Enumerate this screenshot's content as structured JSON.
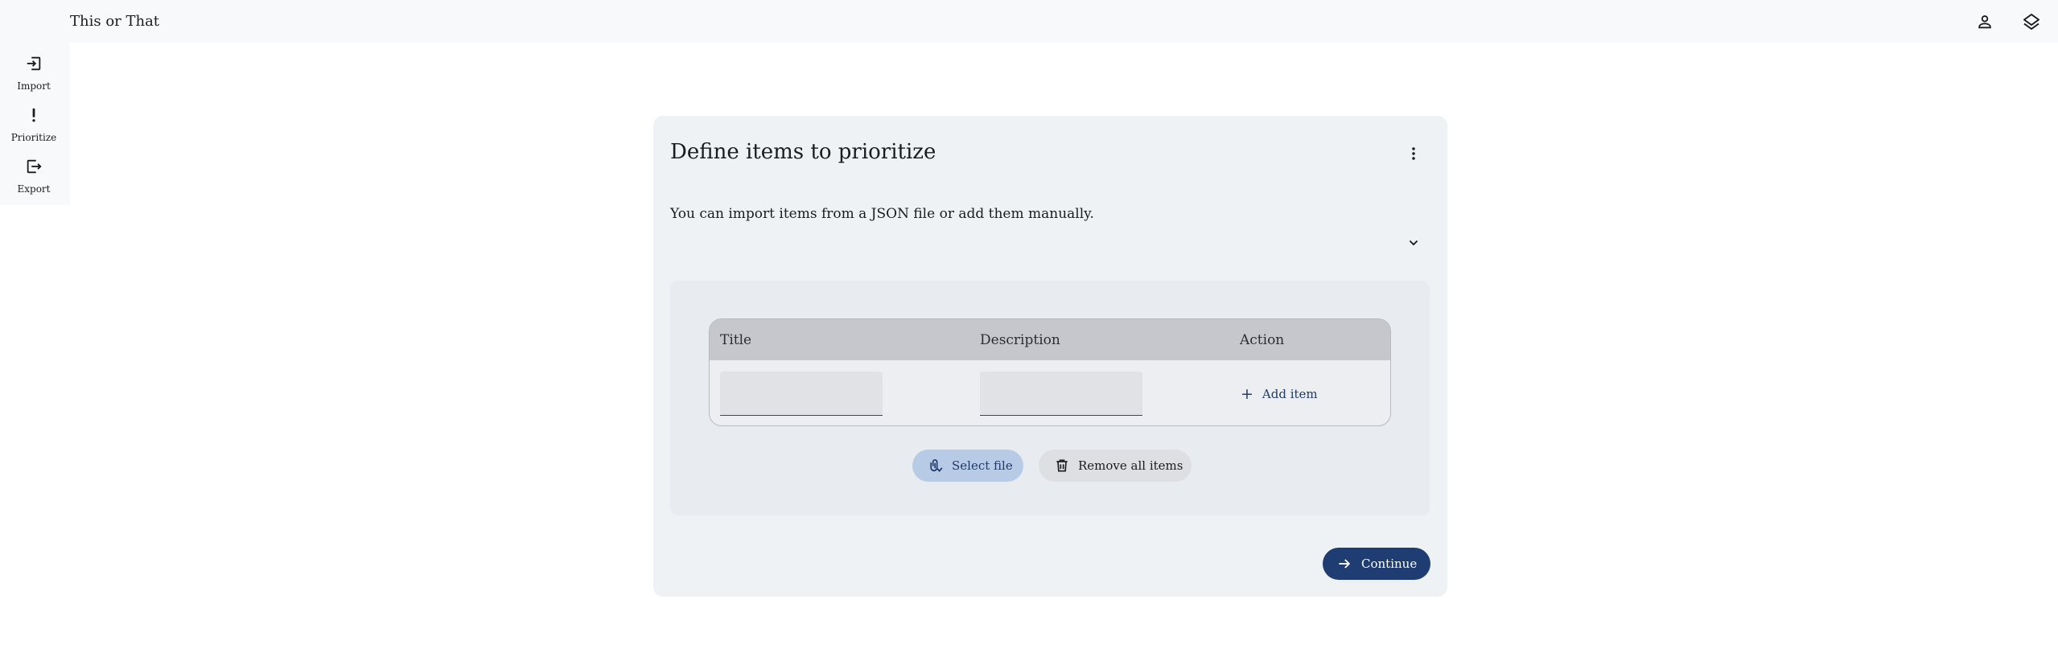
{
  "app": {
    "title": "This or That",
    "icons": {
      "account": "person-icon",
      "theme": "layers-icon"
    }
  },
  "sidebar": {
    "items": [
      {
        "label": "Import",
        "icon": "import-icon"
      },
      {
        "label": "Prioritize",
        "icon": "exclamation-icon"
      },
      {
        "label": "Export",
        "icon": "export-icon"
      }
    ]
  },
  "card": {
    "title": "Define items to prioritize",
    "description": "You can import items from a JSON file or add them manually.",
    "menu_icon": "more-vert-icon",
    "expand_icon": "chevron-down-icon"
  },
  "table": {
    "columns": [
      "Title",
      "Description",
      "Action"
    ],
    "title_input": {
      "value": "",
      "placeholder": ""
    },
    "description_input": {
      "value": "",
      "placeholder": ""
    },
    "add_item_label": "Add item"
  },
  "actions": {
    "select_file_label": "Select file",
    "remove_all_label": "Remove all items",
    "continue_label": "Continue"
  },
  "colors": {
    "primary": "#1f3d73",
    "select_file_bg": "#b8cbe6",
    "card_bg": "#eff2f5",
    "table_header_bg": "#c5c7cc"
  }
}
